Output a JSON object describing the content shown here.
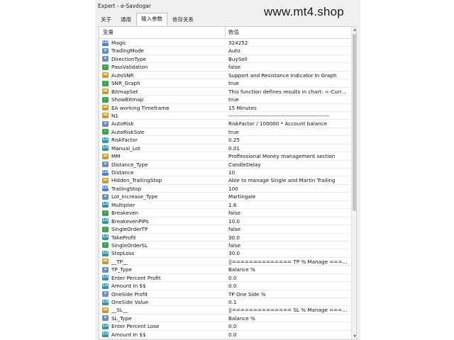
{
  "window": {
    "title": "Expert - e-Savdogar"
  },
  "watermark": "www.mt4.shop",
  "tabs": [
    {
      "label": "关于",
      "active": false
    },
    {
      "label": "通用",
      "active": false
    },
    {
      "label": "输入参数",
      "active": true
    },
    {
      "label": "依存关系",
      "active": false
    }
  ],
  "table": {
    "columns": {
      "variable": "变量",
      "value": "数值"
    },
    "rows": [
      {
        "icon": "int",
        "name": "Magic",
        "value": "324252"
      },
      {
        "icon": "enm",
        "name": "TradingMode",
        "value": "Auto"
      },
      {
        "icon": "enm",
        "name": "DirectionType",
        "value": "BuySell"
      },
      {
        "icon": "bool",
        "name": "PassValidation",
        "value": "false"
      },
      {
        "icon": "str",
        "name": "AutoSNR",
        "value": "Support and Resistance Indicator In Graph"
      },
      {
        "icon": "bool",
        "name": "SNR_Graph",
        "value": "true"
      },
      {
        "icon": "str",
        "name": "BitmapSet",
        "value": "This function defines results in chart: <-Currency / P..."
      },
      {
        "icon": "bool",
        "name": "ShowBitmap",
        "value": "true"
      },
      {
        "icon": "str",
        "name": "EA working Timeframe",
        "value": "15 Minutes"
      },
      {
        "icon": "str",
        "name": "N1",
        "value": "-------------------------------------------------------"
      },
      {
        "icon": "enm",
        "name": "AutoRisk",
        "value": "RiskFactor / 100000 * Account balance"
      },
      {
        "icon": "bool",
        "name": "AutoRiskSize",
        "value": "true"
      },
      {
        "icon": "dbl",
        "name": "RiskFactor",
        "value": "0.25"
      },
      {
        "icon": "dbl",
        "name": "Manual_Lot",
        "value": "0.01"
      },
      {
        "icon": "str",
        "name": "MM",
        "value": "Proffessional Money management section"
      },
      {
        "icon": "enm",
        "name": "Distance_Type",
        "value": "CandleDelay"
      },
      {
        "icon": "int",
        "name": "Distance",
        "value": "10"
      },
      {
        "icon": "str",
        "name": "Hidden_TrailingStop",
        "value": "Able to manage Single and Martin Trailing"
      },
      {
        "icon": "int",
        "name": "TrailingStop",
        "value": "100"
      },
      {
        "icon": "enm",
        "name": "Lot_Increase_Type",
        "value": "Martingale"
      },
      {
        "icon": "dbl",
        "name": "Multiplier",
        "value": "1.6"
      },
      {
        "icon": "bool",
        "name": "Breakeven",
        "value": "false"
      },
      {
        "icon": "dbl",
        "name": "BreakevenPIPs",
        "value": "10.0"
      },
      {
        "icon": "bool",
        "name": "SingleOrderTP",
        "value": "false"
      },
      {
        "icon": "dbl",
        "name": "TakeProfit",
        "value": "30.0"
      },
      {
        "icon": "bool",
        "name": "SingleOrderSL",
        "value": "false"
      },
      {
        "icon": "dbl",
        "name": "StopLoss",
        "value": "30.0"
      },
      {
        "icon": "str",
        "name": "__TP__",
        "value": "||============== TP % Manage ========..."
      },
      {
        "icon": "enm",
        "name": "TP_Type",
        "value": "Balance %"
      },
      {
        "icon": "dbl",
        "name": "Enter Percent Profit",
        "value": "0.0"
      },
      {
        "icon": "dbl",
        "name": "Amount In $$",
        "value": "0.0"
      },
      {
        "icon": "enm",
        "name": "OneSide Profit",
        "value": "TP One Side %"
      },
      {
        "icon": "dbl",
        "name": "OneSide Value",
        "value": "0.1"
      },
      {
        "icon": "str",
        "name": "__SL__",
        "value": "||============== SL % Manage ========..."
      },
      {
        "icon": "enm",
        "name": "SL_Type",
        "value": "Balance %"
      },
      {
        "icon": "dbl",
        "name": "Enter Percent Lose",
        "value": "0.0"
      },
      {
        "icon": "dbl",
        "name": "Amount In $$",
        "value": "0.0"
      }
    ]
  },
  "icon_labels": {
    "int": "123",
    "bool": "✓",
    "str": "ab",
    "dbl": "1/2",
    "enm": "≡"
  },
  "colors": {
    "int": "#4f7fc4",
    "bool": "#3ea24f",
    "str": "#c79b2a",
    "dbl": "#2f95a8",
    "enm": "#6d8fb5"
  }
}
